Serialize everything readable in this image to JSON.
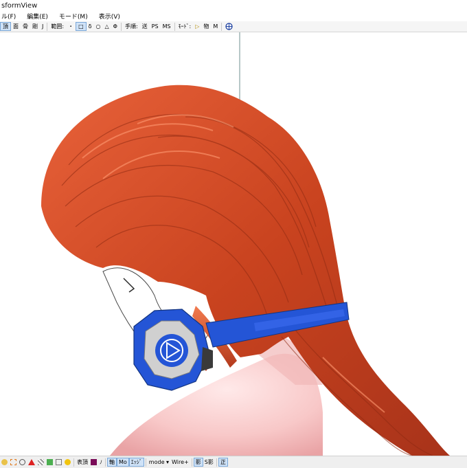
{
  "window": {
    "title": "sformView"
  },
  "menu": [
    "ル(F)",
    "編集(E)",
    "モード(M)",
    "表示(V)"
  ],
  "toolbar": {
    "items": [
      {
        "label": "頂",
        "active": true
      },
      {
        "label": "面",
        "active": false
      },
      {
        "label": "骨",
        "active": false
      },
      {
        "label": "剛",
        "active": false
      },
      {
        "label": "J",
        "active": false
      }
    ],
    "range_label": "範囲:",
    "range_tools": [
      {
        "label": "・",
        "active": false
      },
      {
        "label": "□",
        "active": true
      },
      {
        "label": "δ",
        "active": false
      },
      {
        "label": "○",
        "active": false
      },
      {
        "label": "△",
        "active": false
      },
      {
        "label": "Φ",
        "active": false
      }
    ],
    "sequence_label": "手順:",
    "sequence_items": [
      "送",
      "PS",
      "MS"
    ],
    "mode_label": "ﾓｰﾄﾞ:",
    "mode_items": [
      {
        "label": "▷",
        "color": "#b08800"
      },
      {
        "label": "物",
        "color": "#000000"
      },
      {
        "label": "M",
        "color": "#000000"
      }
    ]
  },
  "status": {
    "items": [
      {
        "label": "表頂",
        "active": false
      },
      {
        "label": "ﾉ",
        "active": false
      },
      {
        "label": "軸",
        "active": true
      },
      {
        "label": "Mo",
        "active": true
      },
      {
        "label": "ｴｯｼﾞ",
        "active": true
      },
      {
        "label": "mode ▾",
        "active": false
      },
      {
        "label": "Wire+",
        "active": false
      },
      {
        "label": "影",
        "active": true
      },
      {
        "label": "S影",
        "active": false
      },
      {
        "label": "正",
        "active": true
      }
    ]
  },
  "colors": {
    "hair": "#c9431f",
    "headphone": "#2455d6",
    "skin": "#f7c9c9"
  }
}
